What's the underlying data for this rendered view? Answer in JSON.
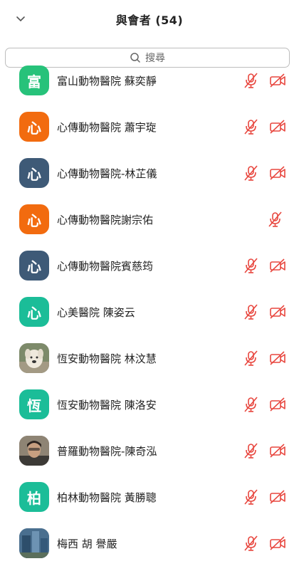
{
  "header": {
    "title": "與會者 (54)"
  },
  "search": {
    "placeholder": "搜尋"
  },
  "colors": {
    "green": "#27c27a",
    "orange": "#f26b0f",
    "slate": "#3e5a77",
    "teal": "#1bbd98",
    "muted_red": "#e8473f"
  },
  "participants": [
    {
      "avatar_text": "富",
      "avatar_color": "#27c27a",
      "name": "富山動物醫院 蘇奕靜",
      "mic": "muted",
      "video": "off"
    },
    {
      "avatar_text": "心",
      "avatar_color": "#f26b0f",
      "name": "心傳動物醫院 蕭宇琁",
      "mic": "muted",
      "video": "off"
    },
    {
      "avatar_text": "心",
      "avatar_color": "#3e5a77",
      "name": "心傳動物醫院-林芷儀",
      "mic": "muted",
      "video": "off"
    },
    {
      "avatar_text": "心",
      "avatar_color": "#f26b0f",
      "name": "心傳動物醫院謝宗佑",
      "mic": "muted",
      "video": "none"
    },
    {
      "avatar_text": "心",
      "avatar_color": "#3e5a77",
      "name": "心傳動物醫院賓慈筠",
      "mic": "muted",
      "video": "off"
    },
    {
      "avatar_text": "心",
      "avatar_color": "#1bbd98",
      "name": "心美醫院 陳姿云",
      "mic": "muted",
      "video": "off"
    },
    {
      "avatar_text": "",
      "avatar_color": "#b9b2a6",
      "avatar_photo": "dog-photo",
      "name": "恆安動物醫院 林汶慧",
      "mic": "muted",
      "video": "off"
    },
    {
      "avatar_text": "恆",
      "avatar_color": "#1bbd98",
      "name": "恆安動物醫院 陳洛安",
      "mic": "muted",
      "video": "off"
    },
    {
      "avatar_text": "",
      "avatar_color": "#7a6b5a",
      "avatar_photo": "person-photo",
      "name": "普羅動物醫院-陳奇泓",
      "mic": "muted",
      "video": "off"
    },
    {
      "avatar_text": "柏",
      "avatar_color": "#1bbd98",
      "name": "柏林動物醫院 黃勝聰",
      "mic": "muted",
      "video": "off"
    },
    {
      "avatar_text": "",
      "avatar_color": "#4a6f8f",
      "avatar_photo": "building-photo",
      "name": "梅西 胡 譽嚴",
      "mic": "muted",
      "video": "off"
    }
  ]
}
